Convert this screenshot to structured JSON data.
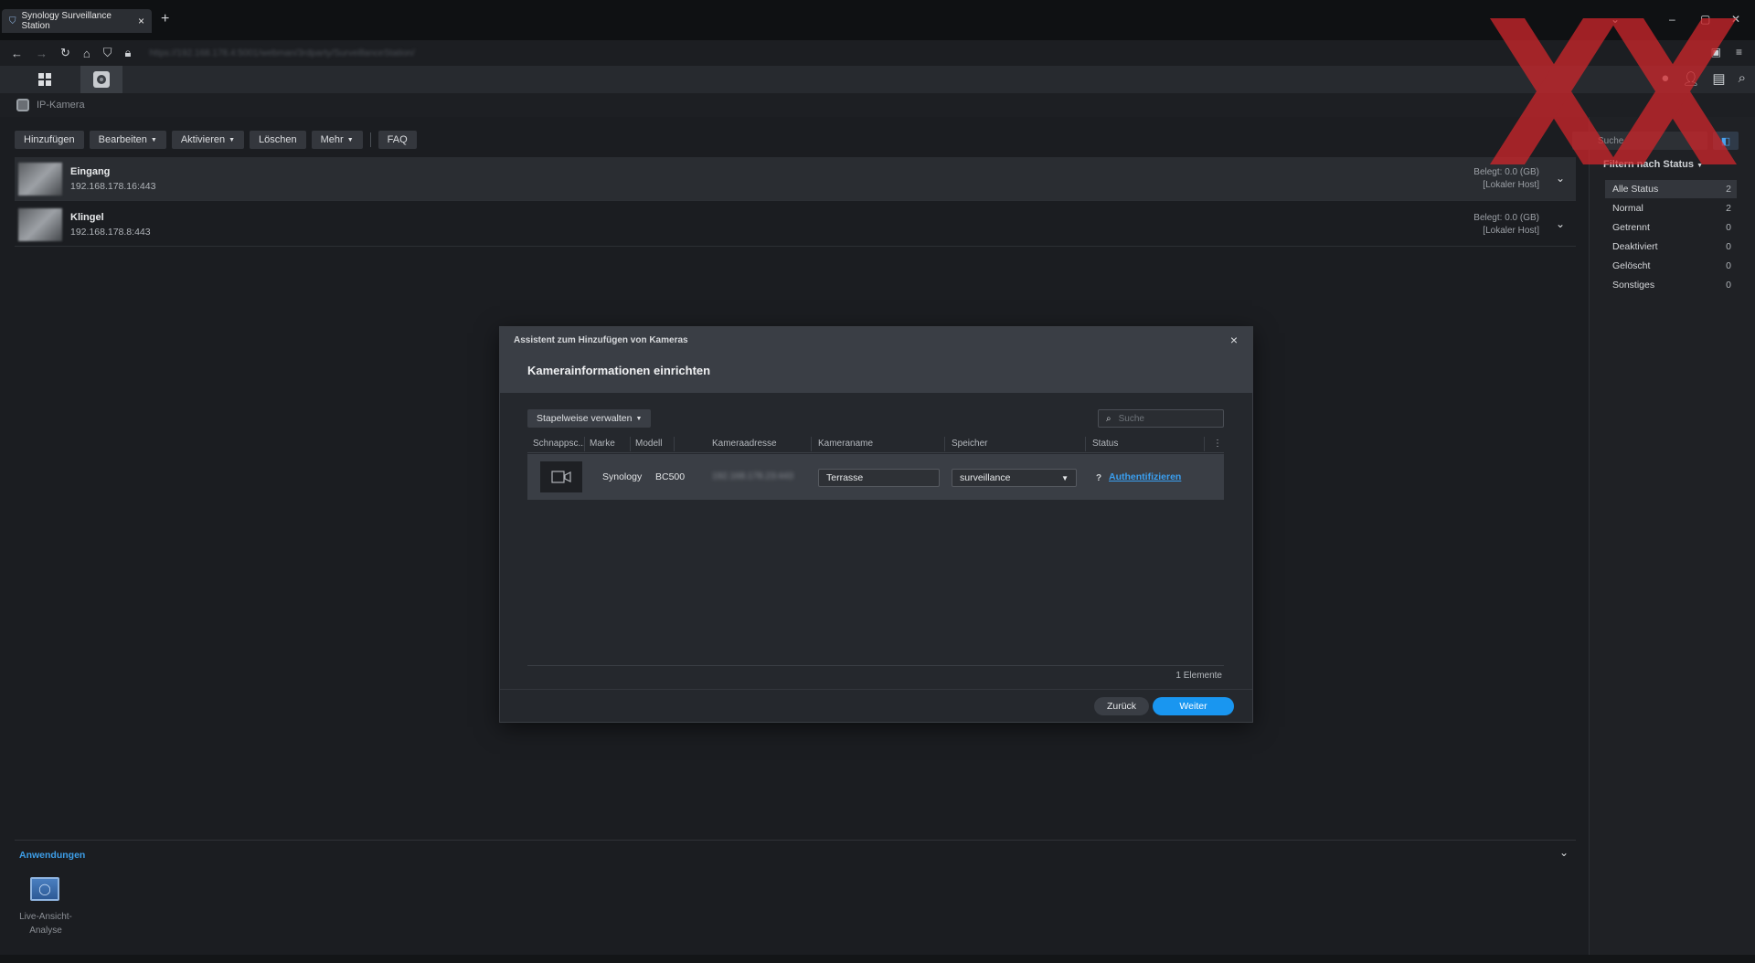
{
  "browser": {
    "tab_title": "Synology Surveillance Station",
    "tab_close": "×",
    "new_tab": "+",
    "win_min": "–",
    "win_max": "▢",
    "win_close": "✕",
    "win_chev": "⌄",
    "url": "https://192.168.178.4:5001/webman/3rdparty/SurveillanceStation/"
  },
  "app": {
    "window_title": "IP-Kamera",
    "toolbar": {
      "add": "Hinzufügen",
      "edit": "Bearbeiten",
      "activate": "Aktivieren",
      "delete": "Löschen",
      "more": "Mehr",
      "faq": "FAQ"
    },
    "cameras": [
      {
        "name": "Eingang",
        "ip": "192.168.178.16:443",
        "used": "Belegt: 0.0 (GB)",
        "host": "[Lokaler Host]"
      },
      {
        "name": "Klingel",
        "ip": "192.168.178.8:443",
        "used": "Belegt: 0.0 (GB)",
        "host": "[Lokaler Host]"
      }
    ],
    "search_placeholder": "Suche",
    "filter": {
      "title": "Filtern nach Status",
      "items": [
        {
          "label": "Alle Status",
          "count": "2"
        },
        {
          "label": "Normal",
          "count": "2"
        },
        {
          "label": "Getrennt",
          "count": "0"
        },
        {
          "label": "Deaktiviert",
          "count": "0"
        },
        {
          "label": "Gelöscht",
          "count": "0"
        },
        {
          "label": "Sonstiges",
          "count": "0"
        }
      ]
    },
    "apps": {
      "title": "Anwendungen",
      "live_label": "Live-Ansicht-Analyse"
    }
  },
  "modal": {
    "title": "Assistent zum Hinzufügen von Kameras",
    "subtitle": "Kamerainformationen einrichten",
    "close": "×",
    "batch_button": "Stapelweise verwalten",
    "search_placeholder": "Suche",
    "columns": {
      "snapshot": "Schnappsc...",
      "brand": "Marke",
      "model": "Modell",
      "address": "Kameraadresse",
      "name": "Kameraname",
      "storage": "Speicher",
      "status": "Status"
    },
    "row": {
      "brand": "Synology",
      "model": "BC500",
      "address": "192.168.178.23:443",
      "name": "Terrasse",
      "storage": "surveillance",
      "status_q": "?",
      "status_link": "Authentifizieren"
    },
    "count": "1 Elemente",
    "back": "Zurück",
    "next": "Weiter"
  },
  "colors": {
    "accent": "#1996f0",
    "link": "#3a9ff0",
    "overlay_x": "#d0262b"
  }
}
